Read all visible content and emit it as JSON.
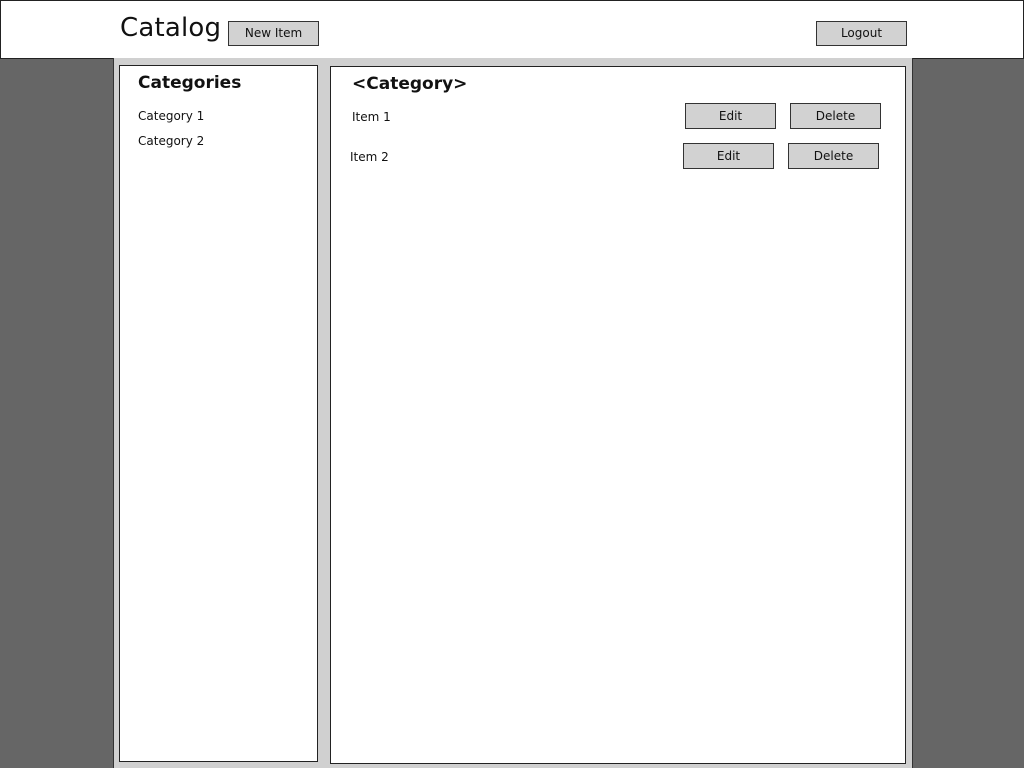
{
  "header": {
    "title": "Catalog",
    "new_item_label": "New Item",
    "logout_label": "Logout"
  },
  "sidebar": {
    "title": "Categories",
    "items": [
      {
        "label": "Category 1"
      },
      {
        "label": "Category 2"
      }
    ]
  },
  "main": {
    "title": "<Category>",
    "items": [
      {
        "label": "Item 1",
        "edit_label": "Edit",
        "delete_label": "Delete"
      },
      {
        "label": "Item 2",
        "edit_label": "Edit",
        "delete_label": "Delete"
      }
    ]
  },
  "colors": {
    "background": "#666666",
    "container": "#d0d0d0",
    "panel": "#ffffff",
    "button": "#d2d2d2"
  }
}
